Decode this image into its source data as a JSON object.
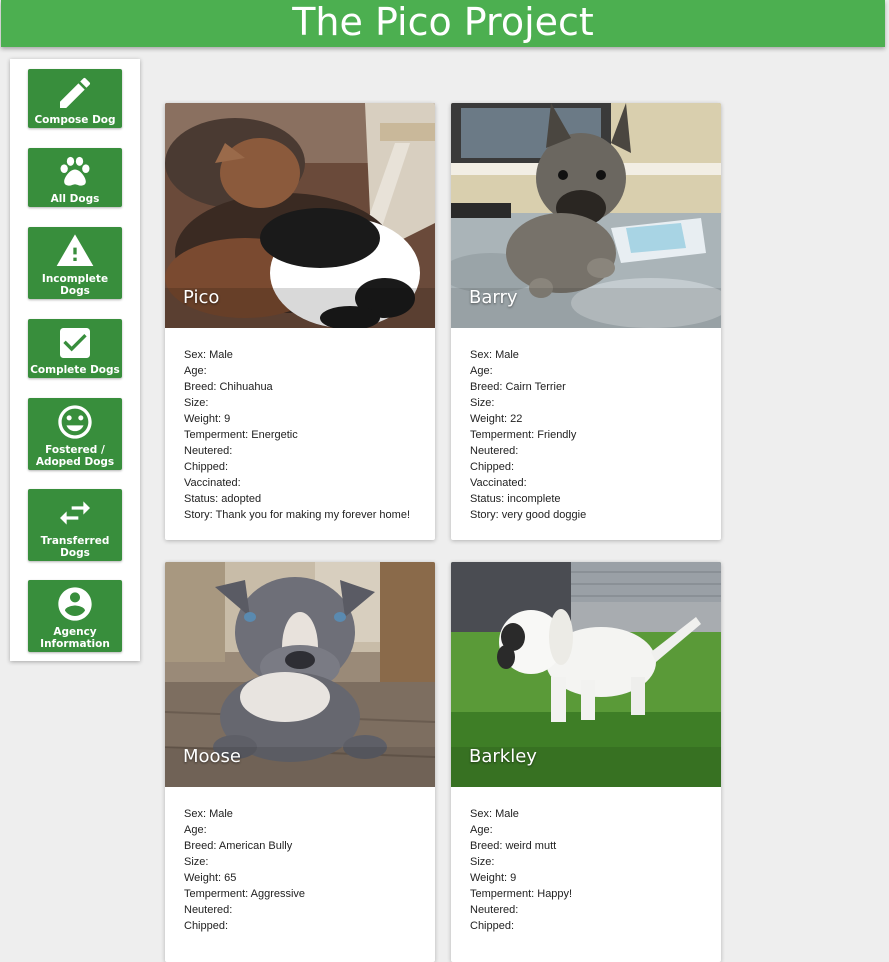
{
  "app": {
    "title": "The Pico Project",
    "accent": "#4caf50",
    "button_color": "#388e3c"
  },
  "sidebar": {
    "items": [
      {
        "label": "Compose Dog",
        "icon": "pencil-icon"
      },
      {
        "label": "All Dogs",
        "icon": "paw-icon"
      },
      {
        "label": "Incomplete\nDogs",
        "icon": "warning-icon"
      },
      {
        "label": "Complete Dogs",
        "icon": "checkbox-icon"
      },
      {
        "label": "Fostered /\nAdoped Dogs",
        "icon": "smiley-icon"
      },
      {
        "label": "Transferred\nDogs",
        "icon": "swap-arrows-icon"
      },
      {
        "label": "Agency\nInformation",
        "icon": "account-circle-icon"
      }
    ]
  },
  "dogs": [
    {
      "name": "Pico",
      "fields": {
        "sex": "Sex: Male",
        "age": "Age:",
        "breed": "Breed: Chihuahua",
        "size": "Size:",
        "weight": "Weight: 9",
        "temperment": "Temperment: Energetic",
        "neutered": "Neutered:",
        "chipped": "Chipped:",
        "vaccinated": "Vaccinated:",
        "status": "Status: adopted",
        "story": "Story: Thank you for making my forever home!"
      }
    },
    {
      "name": "Barry",
      "fields": {
        "sex": "Sex: Male",
        "age": "Age:",
        "breed": "Breed: Cairn Terrier",
        "size": "Size:",
        "weight": "Weight: 22",
        "temperment": "Temperment: Friendly",
        "neutered": "Neutered:",
        "chipped": "Chipped:",
        "vaccinated": "Vaccinated:",
        "status": "Status: incomplete",
        "story": "Story: very good doggie"
      }
    },
    {
      "name": "Moose",
      "fields": {
        "sex": "Sex: Male",
        "age": "Age:",
        "breed": "Breed: American Bully",
        "size": "Size:",
        "weight": "Weight: 65",
        "temperment": "Temperment: Aggressive",
        "neutered": "Neutered:",
        "chipped": "Chipped:"
      }
    },
    {
      "name": "Barkley",
      "fields": {
        "sex": "Sex: Male",
        "age": "Age:",
        "breed": "Breed: weird mutt",
        "size": "Size:",
        "weight": "Weight: 9",
        "temperment": "Temperment: Happy!",
        "neutered": "Neutered:",
        "chipped": "Chipped:"
      }
    }
  ]
}
